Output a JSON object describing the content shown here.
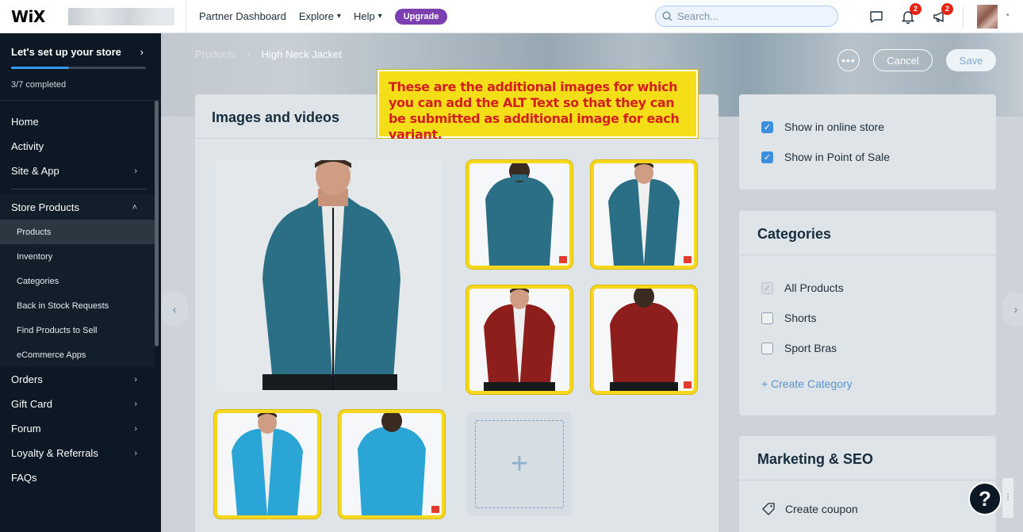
{
  "topbar": {
    "logo": "WiX",
    "nav": [
      {
        "label": "Partner Dashboard"
      },
      {
        "label": "Explore",
        "chevron": "▾"
      },
      {
        "label": "Help",
        "chevron": "▾"
      }
    ],
    "upgrade_label": "Upgrade",
    "search_placeholder": "Search...",
    "notifications_count": "2",
    "announcements_count": "2"
  },
  "sidebar": {
    "setup_title": "Let's set up your store",
    "setup_progress_text": "3/7 completed",
    "setup_progress_fraction": 0.43,
    "items": [
      {
        "label": "Home"
      },
      {
        "label": "Activity"
      },
      {
        "label": "Site & App"
      },
      {
        "label": "Store Products"
      },
      {
        "label": "Orders"
      },
      {
        "label": "Gift Card"
      },
      {
        "label": "Forum"
      },
      {
        "label": "Loyalty & Referrals"
      },
      {
        "label": "FAQs"
      }
    ],
    "store_sub": [
      {
        "label": "Products"
      },
      {
        "label": "Inventory"
      },
      {
        "label": "Categories"
      },
      {
        "label": "Back in Stock Requests"
      },
      {
        "label": "Find Products to Sell"
      },
      {
        "label": "eCommerce Apps"
      }
    ]
  },
  "main": {
    "breadcrumb": [
      "Products",
      "High Neck Jacket"
    ],
    "cancel_label": "Cancel",
    "save_label": "Save",
    "more_label": "•••",
    "images_title": "Images and videos",
    "callout_text": "These are the additional images for which you can add the ALT Text so that they can be submitted as additional image for each variant.",
    "visibility": {
      "online_store": "Show in online store",
      "point_of_sale": "Show in Point of Sale"
    },
    "categories": {
      "title": "Categories",
      "items": [
        "All Products",
        "Shorts",
        "Sport Bras"
      ],
      "create_label": "+ Create Category"
    },
    "marketing": {
      "title": "Marketing & SEO",
      "create_coupon_label": "Create coupon"
    },
    "help_label": "?",
    "colors": {
      "teal": "#2b6f86",
      "red": "#8d1e1c",
      "blue": "#2aa5d6",
      "highlight": "#f5d71e"
    }
  }
}
